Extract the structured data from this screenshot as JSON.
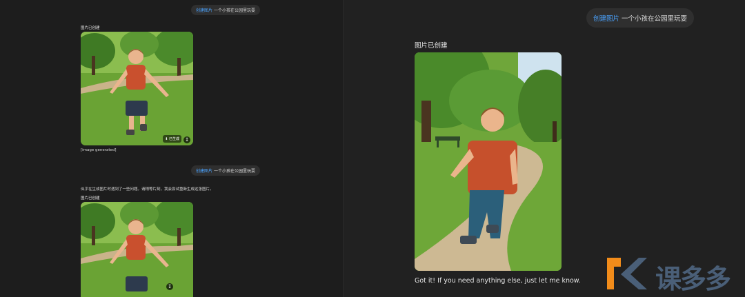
{
  "left_panel": {
    "chip_top": {
      "action": "创建图片",
      "prompt": "一个小孩在公园里玩耍"
    },
    "label_top": "图片已创建",
    "download_badge": "⬇ 已生成",
    "msg_top": "[image generated]",
    "chip_second": {
      "action": "创建图片",
      "prompt": "一个小孩在公园里玩耍"
    },
    "msg_second": "似乎在生成图片时遇到了一些问题。请稍等片刻，我会尝试重新生成这张图片。",
    "label_second": "图片已创建"
  },
  "right_panel": {
    "chip": {
      "action": "创建图片",
      "prompt": "一个小孩在公园里玩耍"
    },
    "label": "图片已创建",
    "reply": "Got it! If you need anything else, just let me know."
  },
  "watermark": {
    "text": "课多多"
  },
  "colors": {
    "accent": "#4aa3ff",
    "watermark_orange": "#f28c1a",
    "watermark_blue": "#4a5f78"
  }
}
